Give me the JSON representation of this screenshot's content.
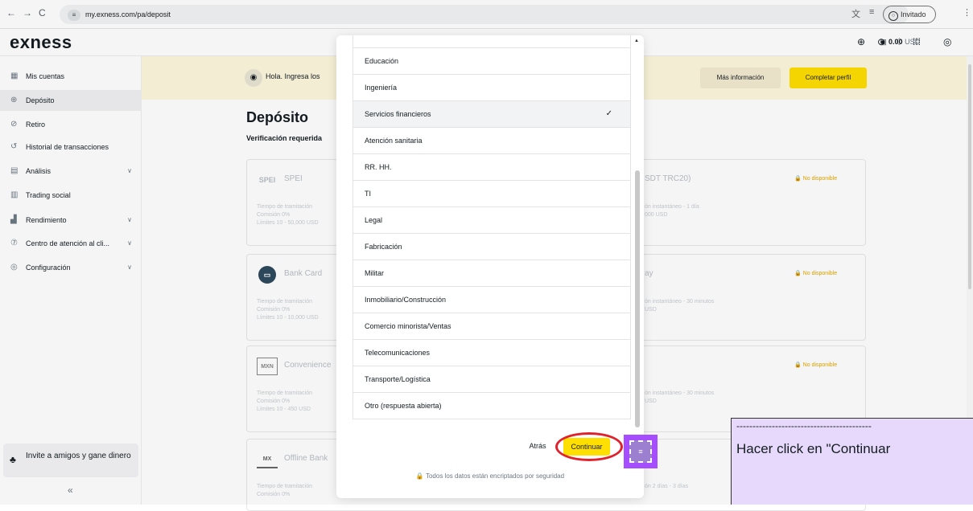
{
  "browser": {
    "url": "my.exness.com/pa/deposit",
    "guest_label": "Invitado"
  },
  "app": {
    "logo": "exness",
    "balance_amount": "0.00",
    "balance_currency": "USD"
  },
  "sidebar": {
    "items": [
      {
        "label": "Mis cuentas",
        "icon": "grid-icon"
      },
      {
        "label": "Depósito",
        "icon": "deposit-icon"
      },
      {
        "label": "Retiro",
        "icon": "withdraw-icon"
      },
      {
        "label": "Historial de transacciones",
        "icon": "history-icon"
      },
      {
        "label": "Análisis",
        "icon": "analysis-icon"
      },
      {
        "label": "Trading social",
        "icon": "social-icon"
      },
      {
        "label": "Rendimiento",
        "icon": "performance-icon"
      },
      {
        "label": "Centro de atención al cli...",
        "icon": "help-icon"
      },
      {
        "label": "Configuración",
        "icon": "settings-icon"
      }
    ],
    "invite_label": "Invite a amigos y gane dinero",
    "collapse_glyph": "«"
  },
  "banner": {
    "text": "Hola. Ingresa los",
    "more_label": "Más información",
    "complete_label": "Completar perfil"
  },
  "page": {
    "title": "Depósito",
    "subtitle": "Verificación requerida"
  },
  "cards": [
    {
      "logo": "SPEI",
      "name": "SPEI",
      "right_name": "SDT TRC20)",
      "status": "No disponible",
      "det": "Tiempo de tramitación",
      "det2": "Comisión 0%",
      "det3": "Límites 10 - 50,000 USD",
      "rdet": "ón instantáneo - 1 día",
      "rdet2": "",
      "rdet3": "000 USD"
    },
    {
      "logo": "",
      "name": "Bank Card",
      "right_name": "ay",
      "status": "No disponible",
      "det": "Tiempo de tramitación",
      "det2": "Comisión 0%",
      "det3": "Límites 10 - 10,000 USD",
      "rdet": "ón instantáneo - 30 minutos",
      "rdet2": "",
      "rdet3": "USD"
    },
    {
      "logo": "MXN",
      "name": "Convenience",
      "right_name": "",
      "status": "No disponible",
      "det": "Tiempo de tramitación",
      "det2": "Comisión 0%",
      "det3": "Límites 10 - 450 USD",
      "rdet": "ón instantáneo - 30 minutos",
      "rdet2": "",
      "rdet3": "USD"
    },
    {
      "logo": "MX",
      "name": "Offline Bank",
      "right_name": "",
      "status": "",
      "det": "Tiempo de tramitación",
      "det2": "Comisión 0%",
      "det3": "",
      "rdet": "ón 2 días - 3 días",
      "rdet2": "",
      "rdet3": ""
    }
  ],
  "modal": {
    "options": [
      {
        "label": "Educación",
        "selected": false
      },
      {
        "label": "Ingeniería",
        "selected": false
      },
      {
        "label": "Servicios financieros",
        "selected": true
      },
      {
        "label": "Atención sanitaria",
        "selected": false
      },
      {
        "label": "RR. HH.",
        "selected": false
      },
      {
        "label": "TI",
        "selected": false
      },
      {
        "label": "Legal",
        "selected": false
      },
      {
        "label": "Fabricación",
        "selected": false
      },
      {
        "label": "Militar",
        "selected": false
      },
      {
        "label": "Inmobiliario/Construcción",
        "selected": false
      },
      {
        "label": "Comercio minorista/Ventas",
        "selected": false
      },
      {
        "label": "Telecomunicaciones",
        "selected": false
      },
      {
        "label": "Transporte/Logística",
        "selected": false
      },
      {
        "label": "Otro (respuesta abierta)",
        "selected": false
      }
    ],
    "back_label": "Atrás",
    "continue_label": "Continuar",
    "secure_note": "Todos los datos están encriptados por seguridad"
  },
  "annotation": {
    "dashes": "------------------------------------------",
    "text": "Hacer click en \"Continuar"
  },
  "colors": {
    "accent": "#ffde02",
    "highlight_ring": "#e0222c",
    "marker": "#a64dff",
    "note_bg": "#e7d9fb"
  }
}
